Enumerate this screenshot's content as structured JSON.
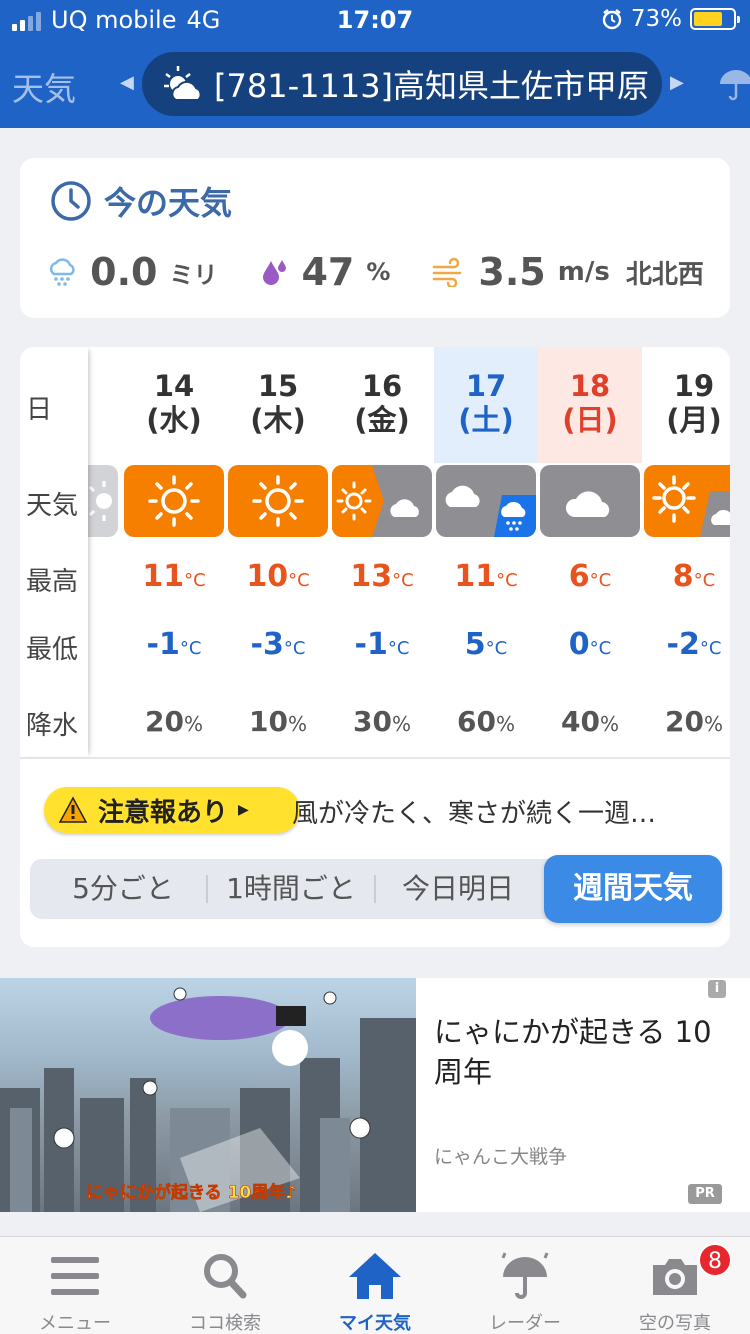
{
  "status": {
    "carrier": "UQ mobile",
    "network": "4G",
    "time": "17:07",
    "battery": "73%",
    "battery_level": 0.73
  },
  "header": {
    "left_label": "天気",
    "location": "[781-1113]高知県土佐市甲原"
  },
  "now": {
    "title": "今の天気",
    "rain_value": "0.0",
    "rain_unit": "ミリ",
    "humidity_value": "47",
    "humidity_unit": "%",
    "wind_value": "3.5",
    "wind_unit": "m/s",
    "wind_dir": "北北西"
  },
  "week": {
    "row_labels": {
      "day": "日",
      "weather": "天気",
      "high": "最高",
      "low": "最低",
      "precip": "降水"
    },
    "deg_unit": "°C",
    "pct_unit": "%",
    "days": [
      {
        "date": "14",
        "dow": "(水)",
        "weather": "sunny",
        "high": "11",
        "low": "-1",
        "precip": "20"
      },
      {
        "date": "15",
        "dow": "(木)",
        "weather": "sunny",
        "high": "10",
        "low": "-3",
        "precip": "10"
      },
      {
        "date": "16",
        "dow": "(金)",
        "weather": "sunny-then-cloudy",
        "high": "13",
        "low": "-1",
        "precip": "30"
      },
      {
        "date": "17",
        "dow": "(土)",
        "weather": "cloudy-then-rain",
        "high": "11",
        "low": "5",
        "precip": "60"
      },
      {
        "date": "18",
        "dow": "(日)",
        "weather": "cloudy",
        "high": "6",
        "low": "0",
        "precip": "40"
      },
      {
        "date": "19",
        "dow": "(月)",
        "weather": "sunny-then-cloudy",
        "high": "8",
        "low": "-2",
        "precip": "20"
      }
    ]
  },
  "alert": {
    "label": "注意報あり",
    "text": "風が冷たく、寒さが続く一週…"
  },
  "segments": {
    "five_min": "5分ごと",
    "hourly": "1時間ごと",
    "today_tomorrow": "今日明日",
    "weekly": "週間天気"
  },
  "ad": {
    "title": "にゃにかが起きる 10周年",
    "brand": "にゃんこ大戦争",
    "pr": "PR",
    "info": "i",
    "banner_text": "にゃにかが起きる 10周年♪"
  },
  "tabs": {
    "menu": "メニュー",
    "search": "ココ検索",
    "my_weather": "マイ天気",
    "radar": "レーダー",
    "photos": "空の写真",
    "photos_badge": "8"
  },
  "colors": {
    "header_blue": "#1f63c6",
    "sunny_orange": "#f77f00",
    "cloudy_gray": "#8e8e93",
    "rain_blue": "#1a73e8",
    "high_red": "#e8541e",
    "low_blue": "#1f63c6",
    "alert_yellow": "#ffe12e",
    "active_segment": "#3b8ae6"
  }
}
